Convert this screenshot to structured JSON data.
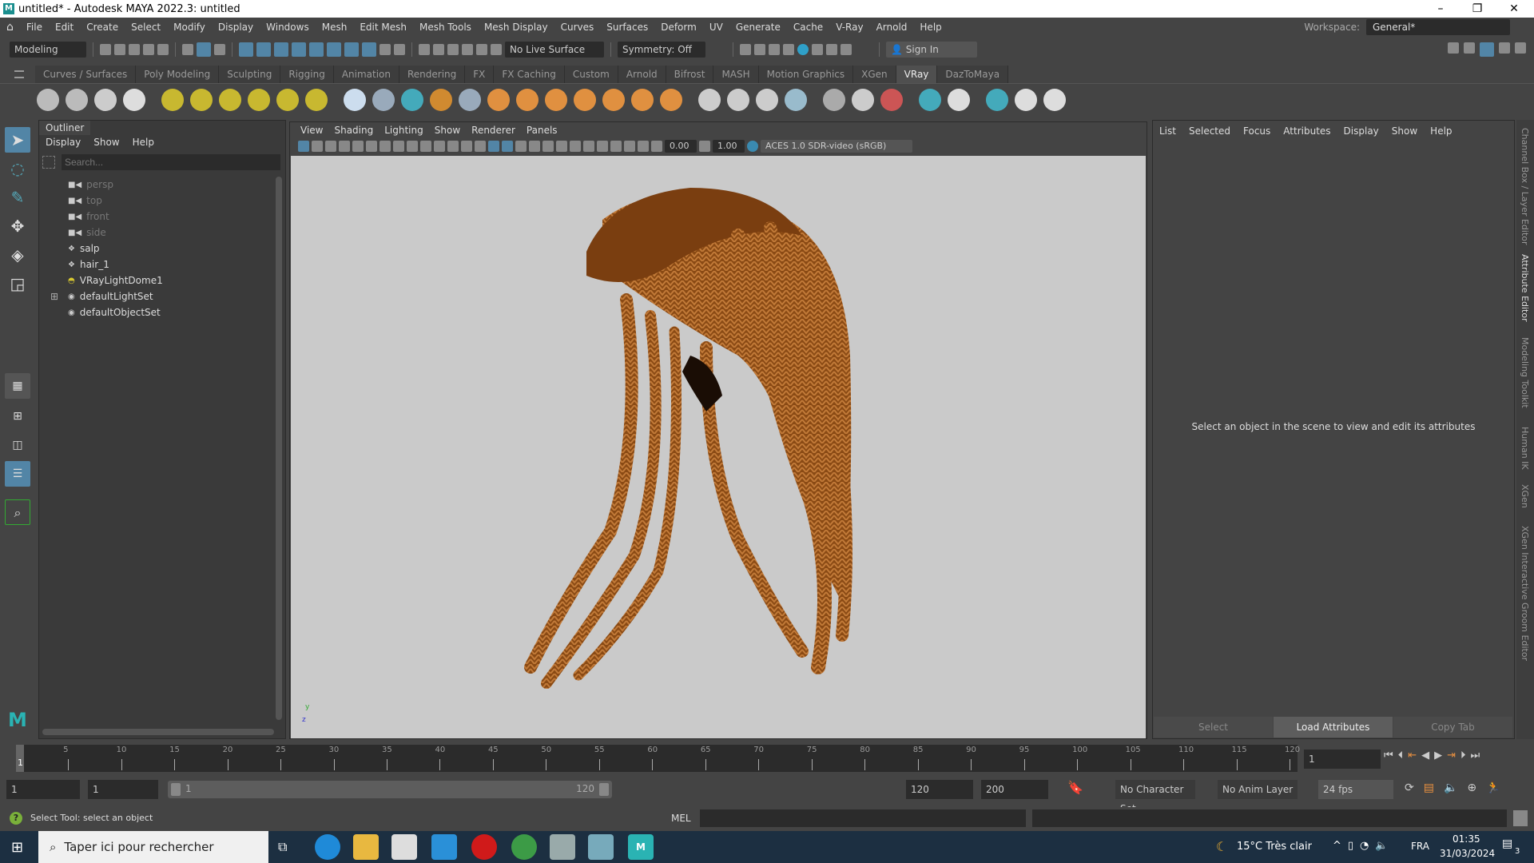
{
  "window": {
    "title": "untitled* - Autodesk MAYA 2022.3: untitled",
    "minimize": "–",
    "maximize": "❐",
    "close": "✕"
  },
  "menu": [
    "File",
    "Edit",
    "Create",
    "Select",
    "Modify",
    "Display",
    "Windows",
    "Mesh",
    "Edit Mesh",
    "Mesh Tools",
    "Mesh Display",
    "Curves",
    "Surfaces",
    "Deform",
    "UV",
    "Generate",
    "Cache",
    "V-Ray",
    "Arnold",
    "Help"
  ],
  "workspace": {
    "label": "Workspace:",
    "value": "General*"
  },
  "statusline": {
    "mode": "Modeling",
    "live_surface": "No Live Surface",
    "symmetry": "Symmetry: Off",
    "sign_in": "Sign In"
  },
  "shelf_tabs": [
    "Curves / Surfaces",
    "Poly Modeling",
    "Sculpting",
    "Rigging",
    "Animation",
    "Rendering",
    "FX",
    "FX Caching",
    "Custom",
    "Arnold",
    "Bifrost",
    "MASH",
    "Motion Graphics",
    "XGen",
    "VRay",
    "DazToMaya"
  ],
  "active_shelf": "VRay",
  "outliner": {
    "title": "Outliner",
    "menu": [
      "Display",
      "Show",
      "Help"
    ],
    "search_placeholder": "Search...",
    "items": [
      {
        "label": "persp",
        "icon": "camera",
        "dim": true
      },
      {
        "label": "top",
        "icon": "camera",
        "dim": true
      },
      {
        "label": "front",
        "icon": "camera",
        "dim": true
      },
      {
        "label": "side",
        "icon": "camera",
        "dim": true
      },
      {
        "label": "salp",
        "icon": "mesh"
      },
      {
        "label": "hair_1",
        "icon": "mesh"
      },
      {
        "label": "VRayLightDome1",
        "icon": "dome-light"
      },
      {
        "label": "defaultLightSet",
        "icon": "set",
        "expandable": true
      },
      {
        "label": "defaultObjectSet",
        "icon": "set"
      }
    ]
  },
  "viewport": {
    "menu": [
      "View",
      "Shading",
      "Lighting",
      "Show",
      "Renderer",
      "Panels"
    ],
    "exposure": "0.00",
    "gamma": "1.00",
    "color_space": "ACES 1.0 SDR-video (sRGB)",
    "axis_y": "y",
    "axis_z": "z"
  },
  "attribute_editor": {
    "menu": [
      "List",
      "Selected",
      "Focus",
      "Attributes",
      "Display",
      "Show",
      "Help"
    ],
    "message": "Select an object in the scene to view and edit its attributes",
    "buttons": [
      "Select",
      "Load Attributes",
      "Copy Tab"
    ]
  },
  "side_tabs": [
    "Channel Box / Layer Editor",
    "Attribute Editor",
    "Modeling Toolkit",
    "Human IK",
    "XGen",
    "XGen Interactive Groom Editor"
  ],
  "timeline": {
    "start": 1,
    "end": 120,
    "step": 5,
    "current_frame": "1",
    "current_label": "1"
  },
  "range": {
    "start": "1",
    "anim_start": "1",
    "range_start": "1",
    "range_end": "120",
    "end": "120",
    "anim_end": "200",
    "character_set": "No Character Set",
    "anim_layer": "No Anim Layer",
    "fps": "24 fps"
  },
  "commandline": {
    "help": "Select Tool: select an object",
    "lang": "MEL"
  },
  "taskbar": {
    "search": "Taper ici pour rechercher",
    "weather": "15°C  Très clair",
    "lang": "FRA",
    "time": "01:35",
    "date": "31/03/2024",
    "notifications": "3"
  },
  "colors": {
    "accent": "#5285a6",
    "viewport_bg": "#cacaca",
    "hair": "#8a4a14"
  }
}
